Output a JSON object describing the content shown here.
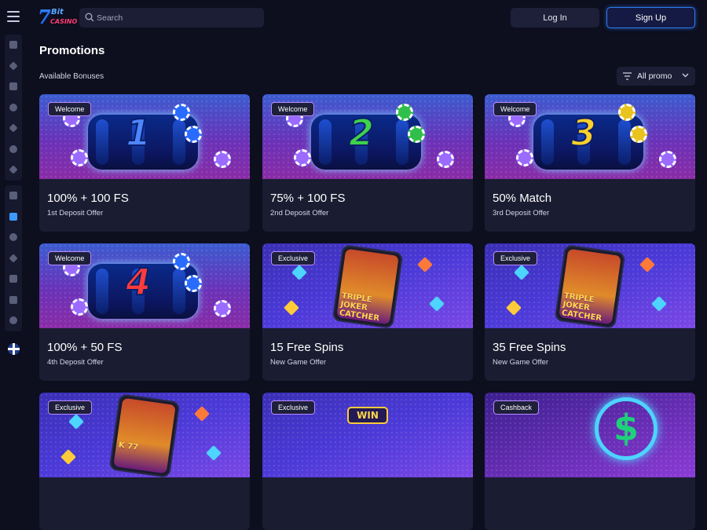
{
  "header": {
    "logo_text": "7Bit Casino",
    "search_placeholder": "Search",
    "login_label": "Log In",
    "signup_label": "Sign Up"
  },
  "sidebar": {
    "group1": [
      {
        "icon": "flame-icon"
      },
      {
        "icon": "puzzle-icon"
      },
      {
        "icon": "fire-icon"
      },
      {
        "icon": "target-icon"
      },
      {
        "icon": "lightning-icon"
      },
      {
        "icon": "clubs-icon"
      },
      {
        "icon": "rocket-icon"
      }
    ],
    "group2": [
      {
        "icon": "camera-icon"
      },
      {
        "icon": "gift-icon",
        "active": true
      },
      {
        "icon": "trophy-icon"
      },
      {
        "icon": "crown-icon"
      },
      {
        "icon": "vip-crown-icon"
      },
      {
        "icon": "wallet-icon"
      },
      {
        "icon": "mail-icon"
      }
    ],
    "language_flag": "uk-flag-icon"
  },
  "page": {
    "title": "Promotions",
    "subtitle": "Available Bonuses",
    "filter_label": "All promo"
  },
  "cards": [
    {
      "tag": "Welcome",
      "title": "100% + 100 FS",
      "desc": "1st Deposit Offer",
      "art": "slot",
      "number": "1",
      "number_color": "#4f86ff",
      "chip_color": "#2a6bff"
    },
    {
      "tag": "Welcome",
      "title": "75% + 100 FS",
      "desc": "2nd Deposit Offer",
      "art": "slot",
      "number": "2",
      "number_color": "#3fd24a",
      "chip_color": "#2fbf4a"
    },
    {
      "tag": "Welcome",
      "title": "50% Match",
      "desc": "3rd Deposit Offer",
      "art": "slot",
      "number": "3",
      "number_color": "#ffd02a",
      "chip_color": "#e9c31e"
    },
    {
      "tag": "Welcome",
      "title": "100% + 50 FS",
      "desc": "4th Deposit Offer",
      "art": "slot",
      "number": "4",
      "number_color": "#ff3b3b",
      "chip_color": "#2a6bff"
    },
    {
      "tag": "Exclusive",
      "title": "15 Free Spins",
      "desc": "New Game Offer",
      "art": "game",
      "game_text": "TRIPLE JOKER CATCHER"
    },
    {
      "tag": "Exclusive",
      "title": "35 Free Spins",
      "desc": "New Game Offer",
      "art": "game",
      "game_text": "TRIPLE JOKER CATCHER"
    },
    {
      "tag": "Exclusive",
      "title": "",
      "desc": "",
      "art": "game",
      "game_text": "K 77"
    },
    {
      "tag": "Exclusive",
      "title": "",
      "desc": "",
      "art": "game",
      "game_text": "WIN"
    },
    {
      "tag": "Cashback",
      "title": "",
      "desc": "",
      "art": "cash",
      "game_text": "$"
    }
  ],
  "colors": {
    "background": "#0d0e1e",
    "panel": "#1c1e35",
    "accent": "#2f7df0",
    "tag_border": "#b58cff"
  }
}
